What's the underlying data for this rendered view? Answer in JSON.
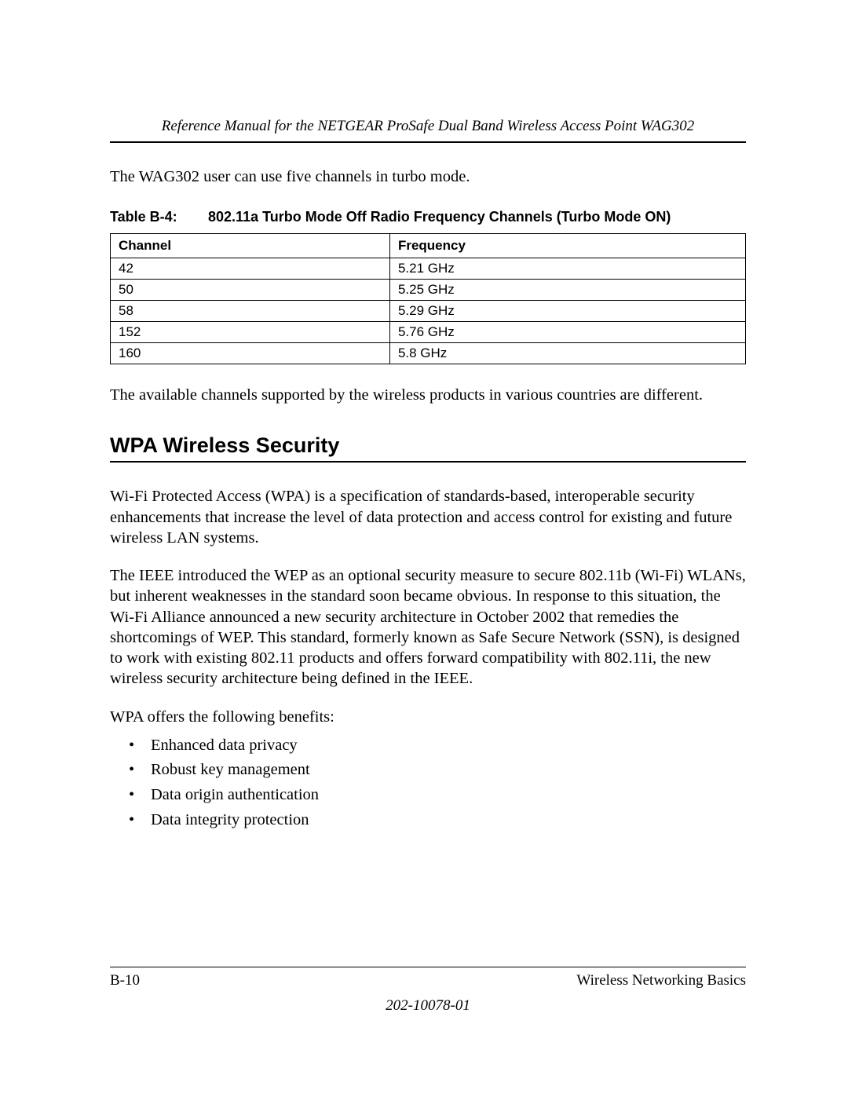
{
  "header": {
    "running_title": "Reference Manual for the NETGEAR ProSafe Dual Band Wireless Access Point WAG302"
  },
  "intro_paragraph": "The WAG302 user can use five channels in turbo mode.",
  "table": {
    "label": "Table B-4:",
    "title": "802.11a Turbo Mode Off Radio Frequency Channels (Turbo Mode ON)",
    "headers": {
      "col1": "Channel",
      "col2": "Frequency"
    },
    "rows": [
      {
        "channel": "42",
        "frequency": "5.21 GHz"
      },
      {
        "channel": "50",
        "frequency": "5.25 GHz"
      },
      {
        "channel": "58",
        "frequency": "5.29 GHz"
      },
      {
        "channel": "152",
        "frequency": "5.76 GHz"
      },
      {
        "channel": "160",
        "frequency": "5.8 GHz"
      }
    ]
  },
  "after_table_paragraph": "The available channels supported by the wireless products in various countries are different.",
  "section": {
    "heading": "WPA Wireless Security",
    "p1": "Wi-Fi Protected Access (WPA) is a specification of standards-based, interoperable security enhancements that increase the level of data protection and access control for existing and future wireless LAN systems.",
    "p2": "The IEEE introduced the WEP as an optional security measure to secure 802.11b (Wi-Fi) WLANs, but inherent weaknesses in the standard soon became obvious. In response to this situation, the Wi-Fi Alliance announced a new security architecture in October 2002 that remedies the shortcomings of WEP. This standard, formerly known as Safe Secure Network (SSN), is designed to work with existing 802.11 products and offers forward compatibility with 802.11i, the new wireless security architecture being defined in the IEEE.",
    "p3": "WPA offers the following benefits:",
    "benefits": [
      "Enhanced data privacy",
      "Robust key management",
      "Data origin authentication",
      "Data integrity protection"
    ]
  },
  "footer": {
    "page_number": "B-10",
    "section_title": "Wireless Networking Basics",
    "doc_number": "202-10078-01"
  }
}
